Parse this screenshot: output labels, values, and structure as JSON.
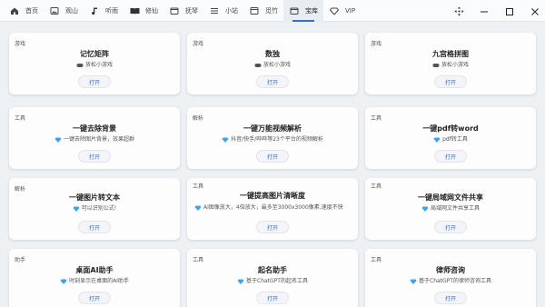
{
  "nav": [
    {
      "id": "home",
      "label": "首页",
      "icon": "home-icon"
    },
    {
      "id": "mountain",
      "label": "观山",
      "icon": "image-icon"
    },
    {
      "id": "music",
      "label": "听雨",
      "icon": "music-note-icon"
    },
    {
      "id": "book",
      "label": "修仙",
      "icon": "book-icon"
    },
    {
      "id": "tools",
      "label": "抚琴",
      "icon": "folder-icon"
    },
    {
      "id": "station",
      "label": "小站",
      "icon": "menu-icon"
    },
    {
      "id": "bamboo",
      "label": "觅竹",
      "icon": "window-icon"
    },
    {
      "id": "treasure",
      "label": "宝库",
      "icon": "folder-icon",
      "active": true
    },
    {
      "id": "vip",
      "label": "VIP",
      "icon": "diamond-icon"
    }
  ],
  "window": {
    "move": "move-icon",
    "minimize": "minimize-icon",
    "maximize": "maximize-icon",
    "close": "close-icon"
  },
  "cards": [
    {
      "category": "游戏",
      "title": "记忆矩阵",
      "desc_icon": "gamepad-icon",
      "desc": "放松小游戏",
      "button": "打开"
    },
    {
      "category": "游戏",
      "title": "数独",
      "desc_icon": "gamepad-icon",
      "desc": "放松小游戏",
      "button": "打开"
    },
    {
      "category": "游戏",
      "title": "九宫格拼图",
      "desc_icon": "gamepad-icon",
      "desc": "放松小游戏",
      "button": "打开"
    },
    {
      "category": "工具",
      "title": "一键去除背景",
      "desc_icon": "diamond-icon",
      "desc": "一键去除图片背景，效果超群",
      "button": "打开"
    },
    {
      "category": "解析",
      "title": "一键万能视频解析",
      "desc_icon": "diamond-icon",
      "desc": "抖音/快手/哔哔等23个平台的视频解析",
      "button": "打开"
    },
    {
      "category": "工具",
      "title": "一键pdf转word",
      "desc_icon": "diamond-icon",
      "desc": "pdf转工具",
      "button": "打开"
    },
    {
      "category": "解析",
      "title": "一键图片转文本",
      "desc_icon": "diamond-icon",
      "desc": "可以识别公式!",
      "button": "打开"
    },
    {
      "category": "工具",
      "title": "一键提高图片清晰度",
      "desc_icon": "diamond-icon",
      "desc": "AI图像放大，4倍放大，最多至3000x3000像素,速度不快",
      "button": "打开"
    },
    {
      "category": "工具",
      "title": "一键局域网文件共享",
      "desc_icon": "diamond-icon",
      "desc": "局域网文件共享工具",
      "button": "打开"
    },
    {
      "category": "助手",
      "title": "桌面AI助手",
      "desc_icon": "diamond-icon",
      "desc": "时刻显示在桌面的AI助手",
      "button": "打开"
    },
    {
      "category": "工具",
      "title": "起名助手",
      "desc_icon": "diamond-icon",
      "desc": "基于ChatGPT的起名工具",
      "button": "打开"
    },
    {
      "category": "工具",
      "title": "律师咨询",
      "desc_icon": "diamond-icon",
      "desc": "基于ChatGPT的律师咨询工具",
      "button": "打开"
    }
  ],
  "colors": {
    "accent": "#2f6fe0",
    "diamond": "#3aa3ff",
    "text": "#333333"
  }
}
